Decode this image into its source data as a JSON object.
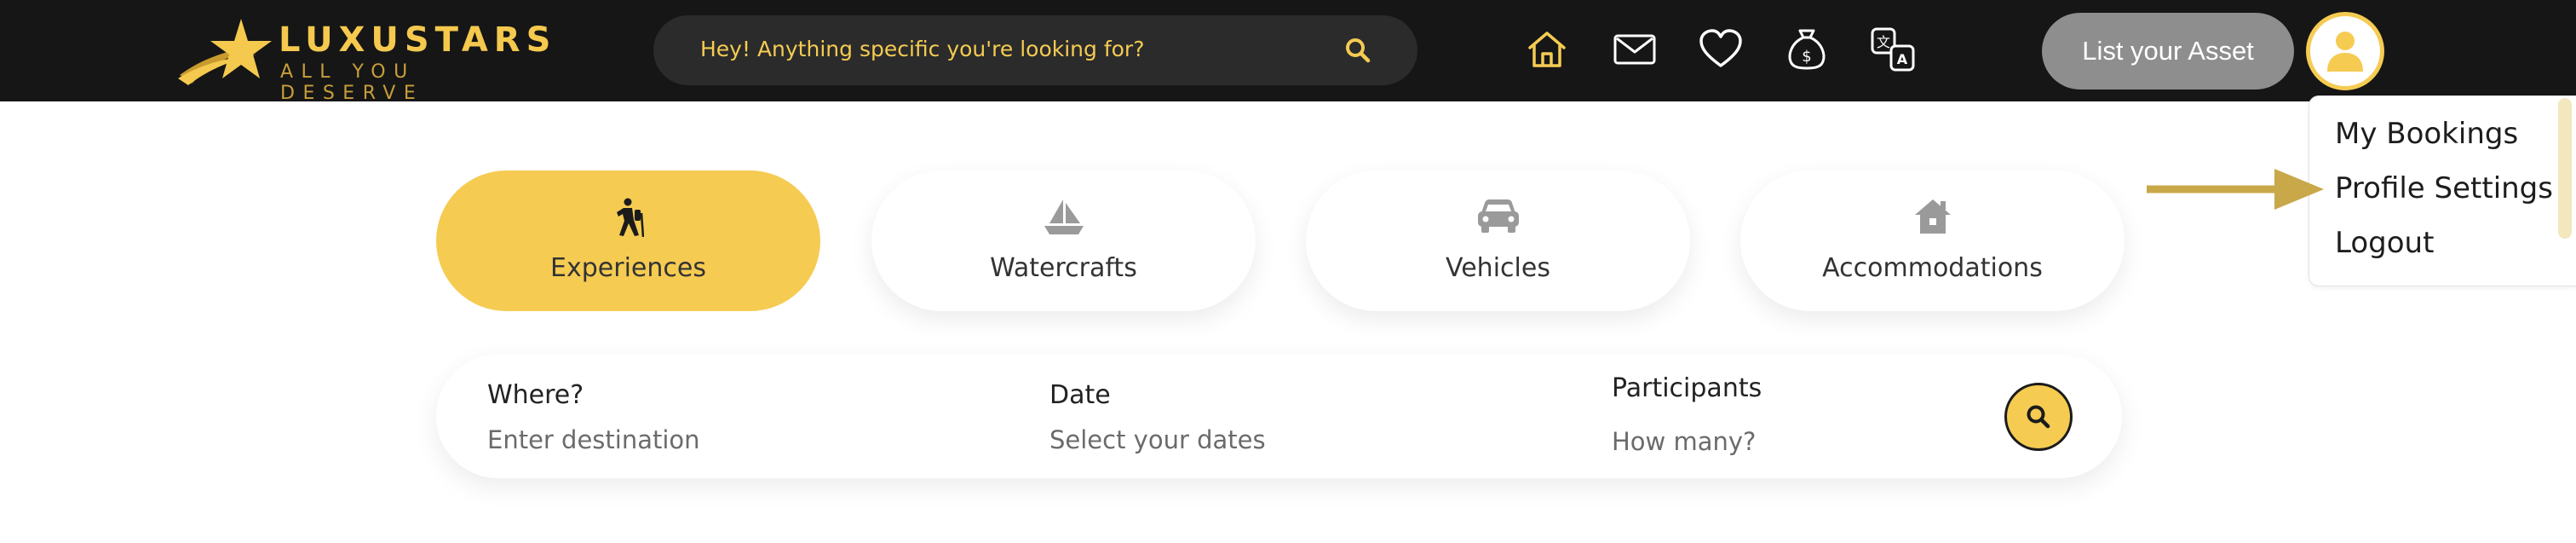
{
  "brand": {
    "name": "LUXUSTARS",
    "tagline": "ALL YOU DESERVE"
  },
  "header": {
    "search": {
      "placeholder": "Hey! Anything specific you're looking for?",
      "icon": "search-icon"
    },
    "nav_icons": [
      "home-icon",
      "mail-icon",
      "heart-icon",
      "money-bag-icon",
      "translate-icon"
    ],
    "list_asset_label": "List your Asset",
    "avatar_icon": "user-icon"
  },
  "user_menu": {
    "items": [
      {
        "label": "My Bookings"
      },
      {
        "label": "Profile Settings",
        "highlighted": true
      },
      {
        "label": "Logout"
      }
    ]
  },
  "categories": [
    {
      "label": "Experiences",
      "icon": "hiker-icon",
      "selected": true
    },
    {
      "label": "Watercrafts",
      "icon": "sailboat-icon",
      "selected": false
    },
    {
      "label": "Vehicles",
      "icon": "car-icon",
      "selected": false
    },
    {
      "label": "Accommodations",
      "icon": "house-icon",
      "selected": false
    }
  ],
  "booking_form": {
    "where": {
      "label": "Where?",
      "placeholder": "Enter destination"
    },
    "date": {
      "label": "Date",
      "placeholder": "Select your dates"
    },
    "participants": {
      "label": "Participants",
      "placeholder": "How many?"
    },
    "submit_icon": "search-icon"
  },
  "colors": {
    "accent": "#f5cb52",
    "topbar": "#161616",
    "search_bg": "#2b2b2b",
    "list_asset_bg": "#8e8e8e",
    "arrow": "#c9a84a",
    "icon_gray": "#9a9a9a"
  }
}
